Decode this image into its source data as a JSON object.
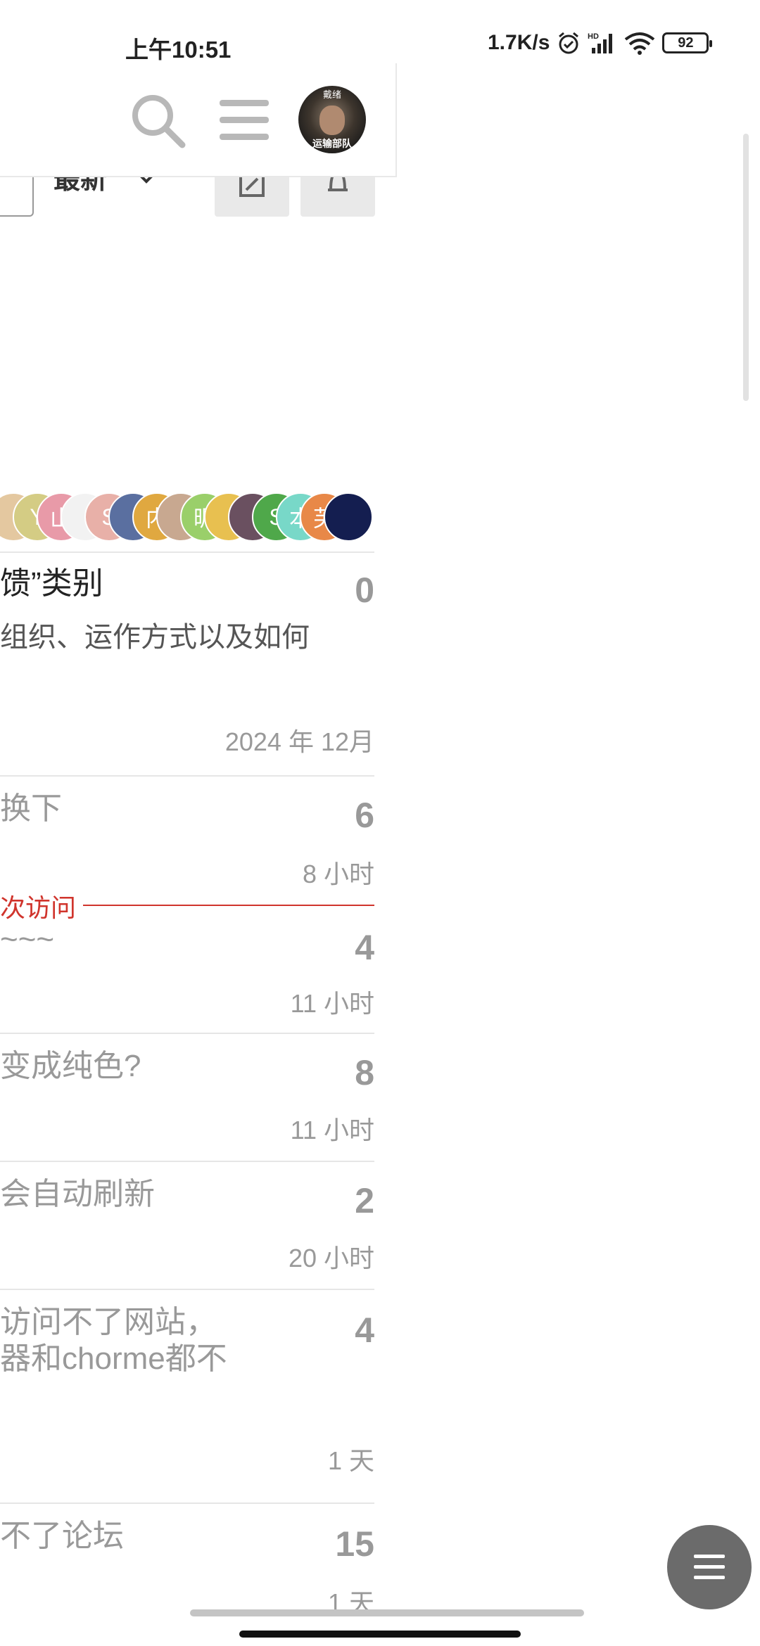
{
  "status_bar": {
    "time": "上午10:51",
    "network_speed": "1.7K/s",
    "battery": "92",
    "icons": [
      "alarm-icon",
      "hd-signal-icon",
      "wifi-icon",
      "battery-icon"
    ]
  },
  "header": {
    "icons": [
      "search-icon",
      "hamburger-menu-icon"
    ],
    "avatar_text": "运输部队",
    "avatar_badge": "戴绪"
  },
  "nav": {
    "sort_label": "最新",
    "buttons": [
      "edit-icon",
      "bell-icon"
    ]
  },
  "avatar_stack": [
    {
      "letter": "",
      "color": "#e4c8a0"
    },
    {
      "letter": "Y",
      "color": "#d4cc84"
    },
    {
      "letter": "山",
      "color": "#e89aa8"
    },
    {
      "letter": "",
      "color": "#f2f2f2"
    },
    {
      "letter": "S",
      "color": "#e8b0a8"
    },
    {
      "letter": "",
      "color": "#5a6fa0"
    },
    {
      "letter": "内",
      "color": "#e0a840"
    },
    {
      "letter": "",
      "color": "#c8a890"
    },
    {
      "letter": "昵",
      "color": "#9acf6a"
    },
    {
      "letter": "",
      "color": "#e8c050"
    },
    {
      "letter": "",
      "color": "#6a5060"
    },
    {
      "letter": "S",
      "color": "#4fa84a"
    },
    {
      "letter": "本",
      "color": "#78d8c8"
    },
    {
      "letter": "芙",
      "color": "#e88848"
    },
    {
      "letter": "",
      "color": "#141e50"
    }
  ],
  "topics": [
    {
      "title": "馈”类别",
      "excerpt": "组织、运作方式以及如何",
      "count": "0",
      "time": "2024 年 12月"
    },
    {
      "title": "换下",
      "count": "6",
      "time": "8 小时"
    },
    {
      "title": "~~~",
      "count": "4",
      "time": "11 小时"
    },
    {
      "title": "变成纯色?",
      "count": "8",
      "time": "11 小时"
    },
    {
      "title": "会自动刷新",
      "count": "2",
      "time": "20 小时"
    },
    {
      "title": "访问不了网站，",
      "title2": "器和chorme都不",
      "count": "4",
      "time": "1 天"
    },
    {
      "title": "不了论坛",
      "count": "15",
      "time": "1 天"
    }
  ],
  "last_visit": "次访问"
}
